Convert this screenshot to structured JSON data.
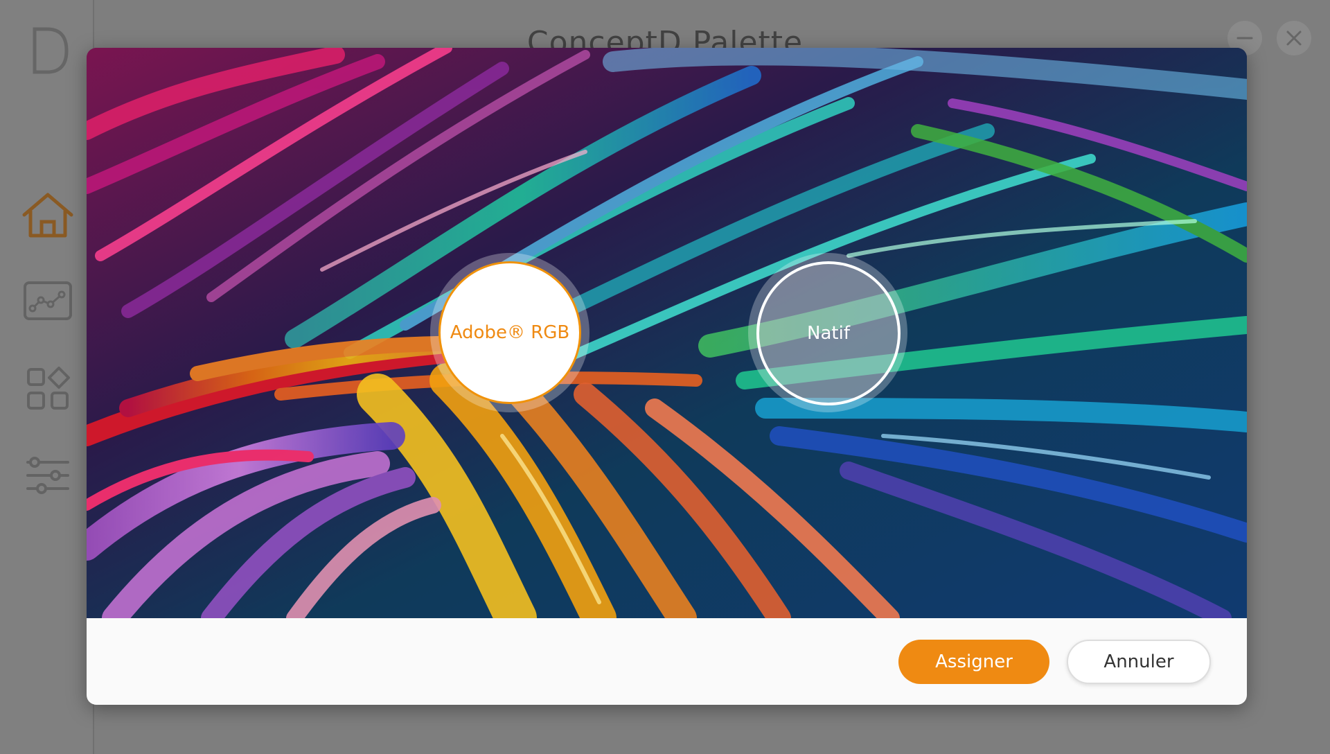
{
  "app": {
    "title": "ConceptD Palette",
    "logo_letter": "D",
    "accent_color": "#ef8a12"
  },
  "sidebar": {
    "items": [
      {
        "icon": "home-icon",
        "active": true
      },
      {
        "icon": "color-curve-icon",
        "active": false
      },
      {
        "icon": "apps-grid-icon",
        "active": false
      },
      {
        "icon": "sliders-icon",
        "active": false
      }
    ]
  },
  "window_controls": {
    "minimize_icon": "minimize-icon",
    "close_icon": "close-icon"
  },
  "dialog": {
    "profiles": [
      {
        "label": "Adobe® RGB",
        "selected": true
      },
      {
        "label": "Natif",
        "selected": false
      }
    ],
    "assign_label": "Assigner",
    "cancel_label": "Annuler"
  }
}
